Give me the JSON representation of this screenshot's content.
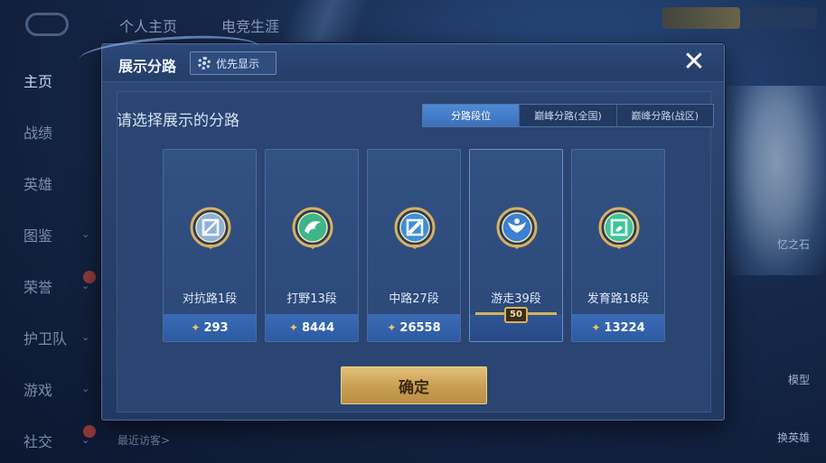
{
  "background": {
    "top_tabs": [
      "个人主页",
      "电竞生涯"
    ],
    "sidebar": [
      {
        "label": "主页",
        "active": true,
        "chevron": false,
        "badge": false
      },
      {
        "label": "战绩",
        "active": false,
        "chevron": false,
        "badge": false
      },
      {
        "label": "英雄",
        "active": false,
        "chevron": false,
        "badge": false
      },
      {
        "label": "图鉴",
        "active": false,
        "chevron": true,
        "badge": false
      },
      {
        "label": "荣誉",
        "active": false,
        "chevron": true,
        "badge": true
      },
      {
        "label": "护卫队",
        "active": false,
        "chevron": true,
        "badge": false
      },
      {
        "label": "游戏",
        "active": false,
        "chevron": true,
        "badge": false
      },
      {
        "label": "社交",
        "active": false,
        "chevron": true,
        "badge": true
      }
    ],
    "recent_visitors": "最近访客>",
    "right_labels": [
      "忆之石",
      "模型",
      "换英雄"
    ]
  },
  "modal": {
    "title": "展示分路",
    "pref_button": "优先显示",
    "close_icon": "close-icon",
    "subtitle": "请选择展示的分路",
    "segments": [
      {
        "label": "分路段位",
        "active": true
      },
      {
        "label": "巅峰分路(全国)",
        "active": false
      },
      {
        "label": "巅峰分路(战区)",
        "active": false
      }
    ],
    "cards": [
      {
        "label": "对抗路1段",
        "score": "293",
        "icon": "clash-lane-icon",
        "color": "#8fb0d8",
        "selected": false
      },
      {
        "label": "打野13段",
        "score": "8444",
        "icon": "jungle-dragon-icon",
        "color": "#3fb58a",
        "selected": false
      },
      {
        "label": "中路27段",
        "score": "26558",
        "icon": "mid-lane-icon",
        "color": "#3d8fd8",
        "selected": false
      },
      {
        "label": "游走39段",
        "score": "50",
        "icon": "roam-wings-icon",
        "color": "#3d7fd0",
        "selected": true
      },
      {
        "label": "发育路18段",
        "score": "13224",
        "icon": "farm-lane-icon",
        "color": "#3fc49a",
        "selected": false
      }
    ],
    "confirm_label": "确定"
  }
}
